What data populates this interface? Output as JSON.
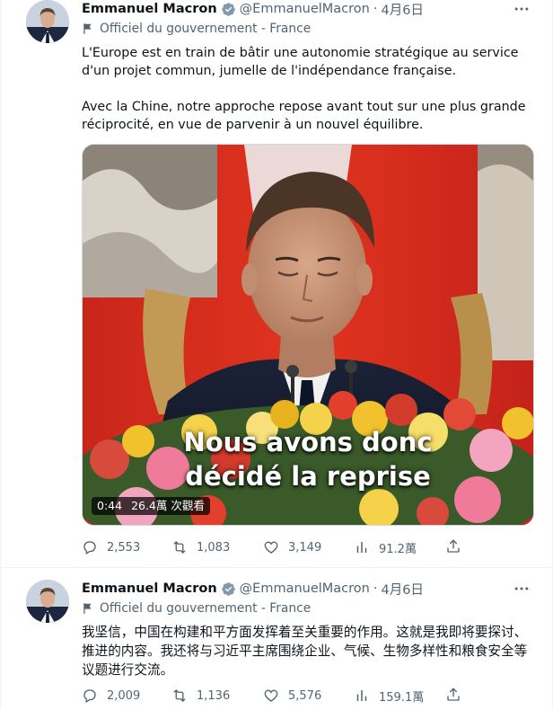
{
  "tweets": [
    {
      "author_name": "Emmanuel Macron",
      "handle": "@EmmanuelMacron",
      "separator": "·",
      "date": "4月6日",
      "label": "Officiel du gouvernement - France",
      "paragraphs": [
        "L'Europe est en train de bâtir une autonomie stratégique au service d'un projet commun, jumelle de l'indépendance française.",
        "Avec la Chine, notre approche repose avant tout sur une plus grande réciprocité, en vue de parvenir à un nouvel équilibre."
      ],
      "video": {
        "caption_line1": "Nous avons donc",
        "caption_line2": "décidé la reprise",
        "duration": "0:44",
        "views": "26.4萬 次觀看"
      },
      "actions": {
        "replies": "2,553",
        "retweets": "1,083",
        "likes": "3,149",
        "views": "91.2萬"
      }
    },
    {
      "author_name": "Emmanuel Macron",
      "handle": "@EmmanuelMacron",
      "separator": "·",
      "date": "4月6日",
      "label": "Officiel du gouvernement - France",
      "paragraphs": [
        "我坚信，中国在构建和平方面发挥着至关重要的作用。这就是我即将要探讨、推进的内容。我还将与习近平主席围绕企业、气候、生物多样性和粮食安全等议题进行交流。"
      ],
      "actions": {
        "replies": "2,009",
        "retweets": "1,136",
        "likes": "5,576",
        "views": "159.1萬"
      }
    }
  ],
  "colors": {
    "text": "#0f1419",
    "secondary": "#536471",
    "verified": "#829aab",
    "divider": "#eff3f4"
  },
  "icons": [
    "verified-badge-icon",
    "more-icon",
    "flag-icon",
    "reply-icon",
    "retweet-icon",
    "like-icon",
    "views-icon",
    "share-icon"
  ]
}
